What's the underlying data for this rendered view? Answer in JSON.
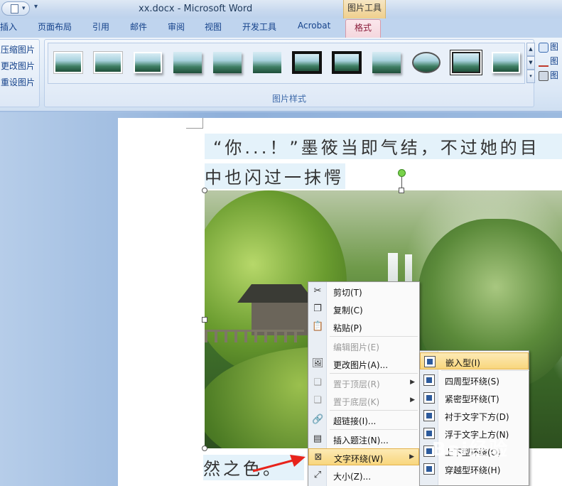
{
  "titlebar": {
    "title": "xx.docx - Microsoft Word",
    "context_tab": "图片工具"
  },
  "tabs": [
    "插入",
    "页面布局",
    "引用",
    "邮件",
    "审阅",
    "视图",
    "开发工具",
    "Acrobat",
    "格式"
  ],
  "active_tab": "格式",
  "ribbon": {
    "adjust_items": [
      "压缩图片",
      "更改图片",
      "重设图片"
    ],
    "styles_group_label": "图片样式",
    "right_items": [
      "图",
      "图",
      "图"
    ]
  },
  "document": {
    "line1": "“你...！”墨筱当即气结，不过她的目",
    "line2": "中也闪过一抹愕",
    "line3": "然之色。"
  },
  "context_menu": {
    "items": [
      {
        "label": "剪切(T)",
        "icon": "scissors-icon",
        "enabled": true
      },
      {
        "label": "复制(C)",
        "icon": "copy-icon",
        "enabled": true
      },
      {
        "label": "粘贴(P)",
        "icon": "paste-icon",
        "enabled": true
      },
      {
        "label": "编辑图片(E)",
        "icon": "",
        "enabled": false
      },
      {
        "label": "更改图片(A)...",
        "icon": "change-picture-icon",
        "enabled": true
      },
      {
        "label": "置于顶层(R)",
        "icon": "bring-front-icon",
        "enabled": false
      },
      {
        "label": "置于底层(K)",
        "icon": "send-back-icon",
        "enabled": false
      },
      {
        "label": "超链接(I)...",
        "icon": "hyperlink-icon",
        "enabled": true
      },
      {
        "label": "插入题注(N)...",
        "icon": "caption-icon",
        "enabled": true
      },
      {
        "label": "文字环绕(W)",
        "icon": "text-wrap-icon",
        "enabled": true
      },
      {
        "label": "大小(Z)...",
        "icon": "size-icon",
        "enabled": true
      }
    ]
  },
  "wrap_submenu": {
    "items": [
      "嵌入型(I)",
      "四周型环绕(S)",
      "紧密型环绕(T)",
      "衬于文字下方(D)",
      "浮于文字上方(N)",
      "上下型环绕(O)",
      "穿越型环绕(H)"
    ]
  },
  "watermark": "Bai经验",
  "colors": {
    "active_tab_border": "#d79aa9",
    "highlight": "#f8d67d",
    "text_highlight": "#e4f2fa"
  }
}
